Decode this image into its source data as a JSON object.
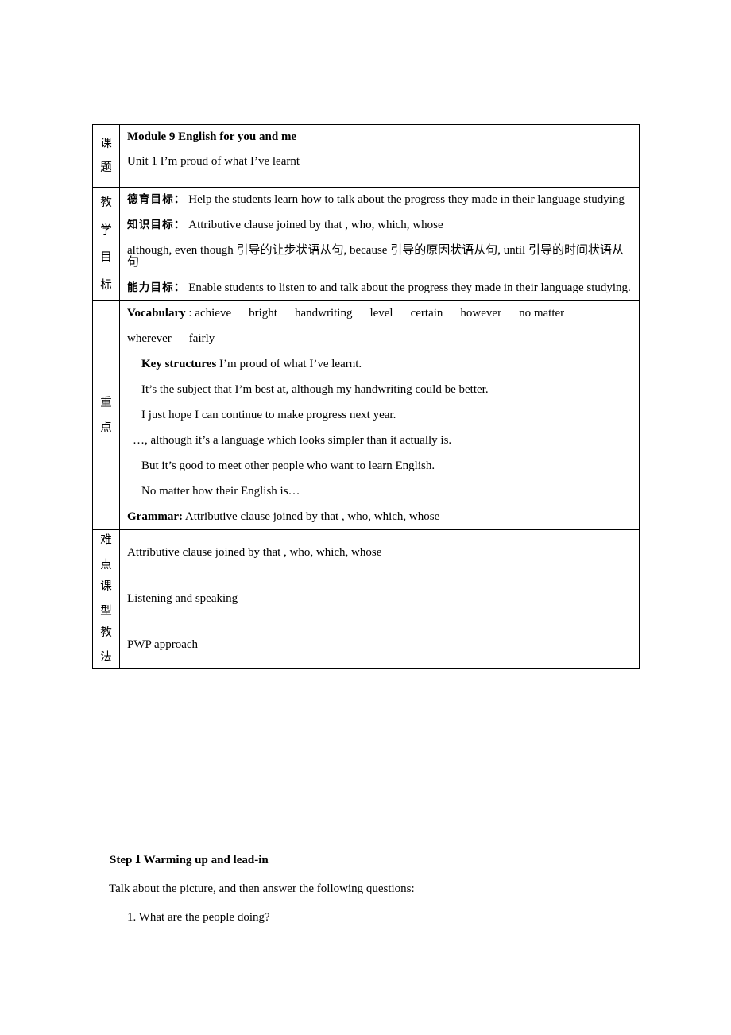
{
  "document": {
    "table": {
      "rows": [
        {
          "label": "课题",
          "label_chars": [
            "课",
            "题"
          ],
          "lines": [
            {
              "text": "Module 9 English for you and me",
              "bold": true
            },
            {
              "text": "Unit 1 I’m proud of what I’ve learnt",
              "bold": false
            }
          ]
        },
        {
          "label": "教学目标",
          "label_chars": [
            "教",
            "学",
            "目",
            "标"
          ],
          "objectives": [
            {
              "label": "德育目标：",
              "text": "  Help the students learn how to talk about the progress they made in their language studying"
            },
            {
              "label": "知识目标：",
              "text": " Attributive clause joined by that , who, which, whose"
            },
            {
              "label": "",
              "text": "although, even though 引导的让步状语从句, because 引导的原因状语从句, until 引导的时间状语从句"
            },
            {
              "label": "能力目标：",
              "text": " Enable students to listen to and talk about the progress they made in their language studying."
            }
          ]
        },
        {
          "label": "重点",
          "label_chars": [
            "重",
            "点"
          ],
          "vocabulary_label": "Vocabulary",
          "vocabulary_sep": " : ",
          "vocabulary": [
            "achieve",
            "bright",
            "handwriting",
            "level",
            "certain",
            "however",
            "no matter",
            "wherever",
            "fairly"
          ],
          "key_structures_label": "Key structures",
          "key_structures": [
            " I’m proud of what I’ve learnt.",
            "It’s the subject that I’m best at, although my handwriting could be better.",
            "I just hope I can continue to make progress next year.",
            "…, although it’s a language which looks simpler than it actually is.",
            "But it’s good to meet other people who want to learn English.",
            "No matter how their English is…"
          ],
          "grammar_label": "Grammar:",
          "grammar_text": " Attributive clause joined by that , who, which, whose"
        },
        {
          "label": "难点",
          "label_chars": [
            "难",
            "点"
          ],
          "lines": [
            {
              "text": "Attributive clause joined by that , who, which, whose",
              "bold": false
            }
          ]
        },
        {
          "label": "课型",
          "label_chars": [
            "课",
            "型"
          ],
          "lines": [
            {
              "text": "Listening and speaking",
              "bold": false
            }
          ]
        },
        {
          "label": "教法",
          "label_chars": [
            "教",
            "法"
          ],
          "lines": [
            {
              "text": "PWP approach",
              "bold": false
            }
          ]
        }
      ]
    },
    "below_table": {
      "step_heading": "Step Ⅰ Warming up and lead-in",
      "instruction": "Talk about the picture, and then answer the following questions:",
      "questions": [
        "1. What are the people doing?"
      ]
    }
  }
}
